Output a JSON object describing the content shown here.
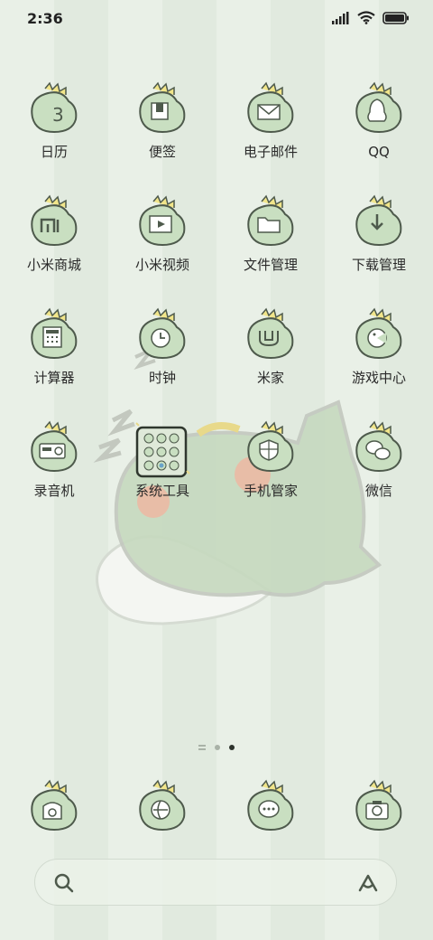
{
  "status": {
    "time": "2:36"
  },
  "apps": [
    {
      "name": "日历",
      "glyph": "3"
    },
    {
      "name": "便签",
      "glyph": "note"
    },
    {
      "name": "电子邮件",
      "glyph": "mail"
    },
    {
      "name": "QQ",
      "glyph": "qq"
    },
    {
      "name": "小米商城",
      "glyph": "mi"
    },
    {
      "name": "小米视频",
      "glyph": "video"
    },
    {
      "name": "文件管理",
      "glyph": "folder"
    },
    {
      "name": "下载管理",
      "glyph": "download"
    },
    {
      "name": "计算器",
      "glyph": "calc"
    },
    {
      "name": "时钟",
      "glyph": "clock"
    },
    {
      "name": "米家",
      "glyph": "home"
    },
    {
      "name": "游戏中心",
      "glyph": "game"
    },
    {
      "name": "录音机",
      "glyph": "radio"
    },
    {
      "name": "系统工具",
      "glyph": "folder-grid"
    },
    {
      "name": "手机管家",
      "glyph": "shield"
    },
    {
      "name": "微信",
      "glyph": "wechat"
    }
  ],
  "dock": [
    {
      "name": "phone",
      "glyph": "phone"
    },
    {
      "name": "browser",
      "glyph": "browser"
    },
    {
      "name": "messages",
      "glyph": "message"
    },
    {
      "name": "camera",
      "glyph": "camera"
    }
  ],
  "colors": {
    "dino": "#c9dfc1",
    "outline": "#4e5a4c",
    "spike": "#f1e58a"
  }
}
